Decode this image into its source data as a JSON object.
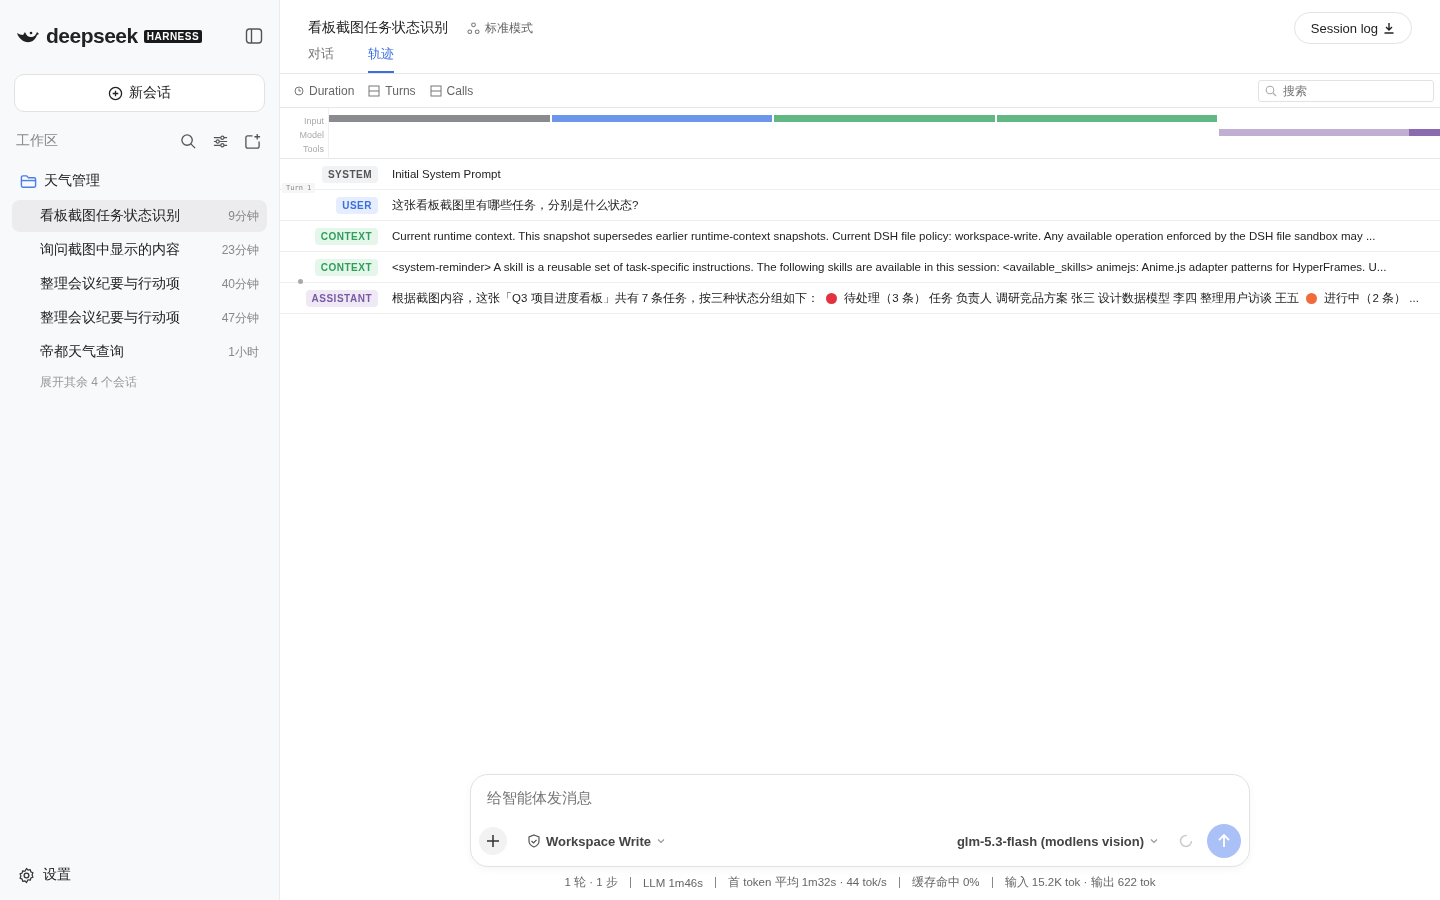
{
  "brand": {
    "name": "deepseek",
    "badge": "HARNESS"
  },
  "sidebar": {
    "new_chat": "新会话",
    "workspace_label": "工作区",
    "folder": "天气管理",
    "items": [
      {
        "title": "看板截图任务状态识别",
        "time": "9分钟",
        "selected": true
      },
      {
        "title": "询问截图中显示的内容",
        "time": "23分钟",
        "selected": false
      },
      {
        "title": "整理会议纪要与行动项",
        "time": "40分钟",
        "selected": false
      },
      {
        "title": "整理会议纪要与行动项",
        "time": "47分钟",
        "selected": false
      },
      {
        "title": "帝都天气查询",
        "time": "1小时",
        "selected": false
      }
    ],
    "expand_more": "展开其余 4 个会话",
    "settings": "设置"
  },
  "header": {
    "title": "看板截图任务状态识别",
    "mode": "标准模式",
    "session_log": "Session log",
    "tabs": [
      {
        "label": "对话",
        "selected": false
      },
      {
        "label": "轨迹",
        "selected": true
      }
    ]
  },
  "toolbar": {
    "views": [
      {
        "label": "Duration",
        "kind": "clock"
      },
      {
        "label": "Turns",
        "kind": "split"
      },
      {
        "label": "Calls",
        "kind": "split"
      }
    ],
    "search": {
      "placeholder": "搜索"
    }
  },
  "timeline": {
    "lanes": [
      "Input",
      "Model",
      "Tools"
    ],
    "segments": [
      {
        "kind": "input",
        "color": "#8a8b8f"
      },
      {
        "kind": "input",
        "color": "#6b96ea"
      },
      {
        "kind": "input",
        "color": "#62b883"
      },
      {
        "kind": "input",
        "color": "#62b883"
      },
      {
        "kind": "model",
        "color": "#c0aed4"
      },
      {
        "kind": "model",
        "color": "#8a6bb0"
      }
    ]
  },
  "trace": [
    {
      "kind": "system",
      "label": "SYSTEM",
      "parts": [
        {
          "kind": "text",
          "text": "Initial System Prompt"
        }
      ]
    },
    {
      "kind": "user",
      "label": "USER",
      "turn": "Turn 1",
      "parts": [
        {
          "kind": "text",
          "text": "这张看板截图里有哪些任务，分别是什么状态?"
        }
      ]
    },
    {
      "kind": "context",
      "label": "CONTEXT",
      "parts": [
        {
          "kind": "text",
          "text": "Current runtime context. This snapshot supersedes earlier runtime-context snapshots. Current DSH file policy: workspace-write. Any available operation enforced by the DSH file sandbox may ..."
        }
      ]
    },
    {
      "kind": "context",
      "label": "CONTEXT",
      "parts": [
        {
          "kind": "text",
          "text": "<system-reminder> A skill is a reusable set of task-specific instructions. The following skills are available in this session: <available_skills> animejs: Anime.js adapter patterns for HyperFrames. U..."
        }
      ]
    },
    {
      "kind": "assistant",
      "label": "ASSISTANT",
      "marker": true,
      "parts": [
        {
          "kind": "text",
          "text": "根据截图内容，这张「Q3 项目进度看板」共有 7 条任务，按三种状态分组如下："
        },
        {
          "kind": "dot",
          "color": "#e2323f"
        },
        {
          "kind": "text",
          "text": "待处理（3 条） 任务 负责人 调研竞品方案 张三 设计数据模型 李四 整理用户访谈 王五"
        },
        {
          "kind": "dot",
          "color": "#f26a3a"
        },
        {
          "kind": "text",
          "text": "进行中（2 条） ..."
        }
      ]
    }
  ],
  "composer": {
    "placeholder": "给智能体发消息",
    "permission": "Workspace Write",
    "model": "glm-5.3-flash (modlens vision)"
  },
  "stats": [
    "1 轮 · 1 步",
    "LLM 1m46s",
    "首 token 平均 1m32s · 44 tok/s",
    "缓存命中 0%",
    "输入 15.2K tok · 输出 622 tok"
  ]
}
